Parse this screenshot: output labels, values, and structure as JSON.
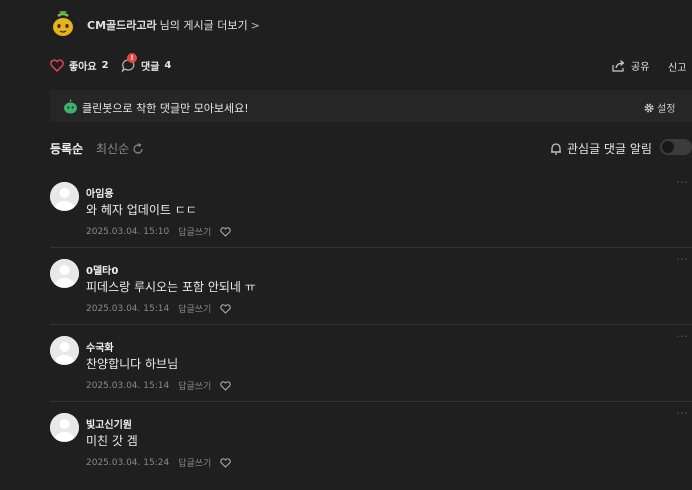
{
  "post": {
    "author_name": "CM골드라고라",
    "author_suffix": "님의 게시글 더보기",
    "chevron": ">"
  },
  "actions": {
    "like_label": "좋아요",
    "like_count": "2",
    "comment_label": "댓글",
    "comment_count": "4",
    "comment_badge": "!",
    "share_label": "공유",
    "report_label": "신고"
  },
  "cleanbot": {
    "message": "클린봇으로 착한 댓글만 모아보세요!",
    "settings_label": "설정"
  },
  "sort": {
    "registered": "등록순",
    "latest": "최신순"
  },
  "notify": {
    "label": "관심글 댓글 알림",
    "enabled": false
  },
  "comments": [
    {
      "nickname": "아임용",
      "text": "와 헤자 업데이트 ㄷㄷ",
      "date": "2025.03.04. 15:10",
      "reply": "답글쓰기"
    },
    {
      "nickname": "0델타0",
      "text": "피데스랑 루시오는 포함 안되네 ㅠ",
      "date": "2025.03.04. 15:14",
      "reply": "답글쓰기"
    },
    {
      "nickname": "수국화",
      "text": "찬양합니다 하브님",
      "date": "2025.03.04. 15:14",
      "reply": "답글쓰기"
    },
    {
      "nickname": "빛고신기원",
      "text": "미친 갓 겜",
      "date": "2025.03.04. 15:24",
      "reply": "답글쓰기"
    }
  ],
  "colors": {
    "background": "#1f1f1f",
    "like_heart": "#e5484d",
    "cleanbot_green": "#3db26b",
    "badge_red": "#e5483f"
  },
  "icons": {
    "author_avatar": "golden-mandrake-icon",
    "like": "heart-icon",
    "comment": "speech-bubble-icon",
    "share": "share-icon",
    "cleanbot": "cleanbot-icon",
    "settings": "gear-icon",
    "sort_latest": "refresh-icon",
    "notify": "bell-icon",
    "comment_like": "heart-outline-icon",
    "comment_more": "more-dots-icon"
  }
}
